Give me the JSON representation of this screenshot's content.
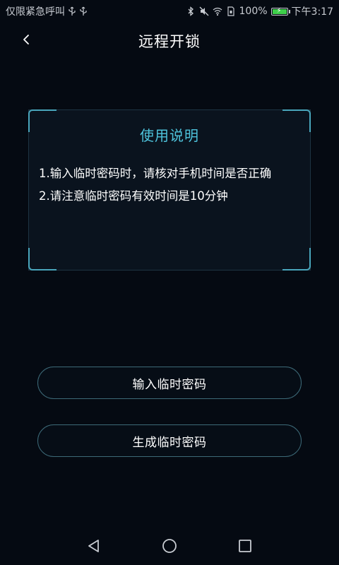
{
  "status_bar": {
    "carrier": "仅限紧急呼叫",
    "battery": "100%",
    "time": "下午3:17",
    "icons": [
      "usb-icon",
      "usb-icon",
      "bluetooth-icon",
      "mute-icon",
      "wifi-icon",
      "sim-icon",
      "battery-icon"
    ],
    "battery_level": 1.0
  },
  "nav": {
    "back_icon": "chevron-left-icon",
    "title": "远程开锁"
  },
  "instructions": {
    "title": "使用说明",
    "items": [
      "1.输入临时密码时，请核对手机时间是否正确",
      "2.请注意临时密码有效时间是10分钟"
    ]
  },
  "actions": {
    "enter_temp_password": "输入临时密码",
    "generate_temp_password": "生成临时密码"
  },
  "system_nav": {
    "icons": [
      "back-triangle-icon",
      "home-circle-icon",
      "recent-square-icon"
    ]
  },
  "colors": {
    "background": "#050a12",
    "accent": "#4ec3dc",
    "button_border": "#3d6a78",
    "battery_fill": "#3ecf4a"
  }
}
